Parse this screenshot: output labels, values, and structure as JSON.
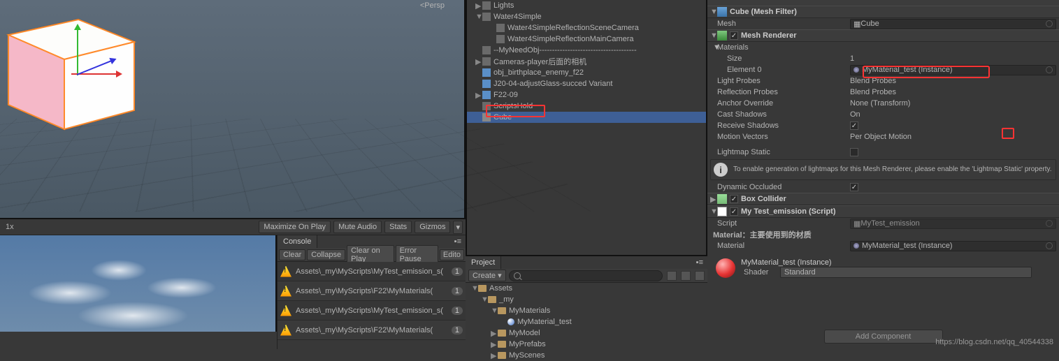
{
  "scene": {
    "camera_label": "<Persp"
  },
  "scene_toolbar": {
    "scale": "1x",
    "maximize": "Maximize On Play",
    "mute": "Mute Audio",
    "stats": "Stats",
    "gizmos": "Gizmos"
  },
  "console": {
    "tab": "Console",
    "buttons": {
      "clear": "Clear",
      "collapse": "Collapse",
      "clear_on_play": "Clear on Play",
      "error_pause": "Error Pause",
      "editor": "Edito"
    },
    "logs": [
      {
        "text": "Assets\\_my\\MyScripts\\MyTest_emission_s(",
        "count": "1"
      },
      {
        "text": "Assets\\_my\\MyScripts\\F22\\MyMaterials(",
        "count": "1"
      },
      {
        "text": "Assets\\_my\\MyScripts\\MyTest_emission_s(",
        "count": "1"
      },
      {
        "text": "Assets\\_my\\MyScripts\\F22\\MyMaterials(",
        "count": "1"
      }
    ]
  },
  "hierarchy": {
    "items": [
      {
        "name": "Lights",
        "indent": 1,
        "arrow": "▶",
        "ico": "go"
      },
      {
        "name": "Water4Simple",
        "indent": 1,
        "arrow": "▼",
        "ico": "go"
      },
      {
        "name": "Water4SimpleReflectionSceneCamera",
        "indent": 2,
        "arrow": "",
        "ico": "go"
      },
      {
        "name": "Water4SimpleReflectionMainCamera",
        "indent": 2,
        "arrow": "",
        "ico": "go"
      },
      {
        "name": "--MyNeedObj--------------------------------------",
        "indent": 1,
        "arrow": "",
        "ico": "go"
      },
      {
        "name": "Cameras-player后面的相机",
        "indent": 1,
        "arrow": "▶",
        "ico": "go"
      },
      {
        "name": "obj_birthplace_enemy_f22",
        "indent": 1,
        "arrow": "",
        "ico": "pref"
      },
      {
        "name": "J20-04-adjustGlass-succed Variant",
        "indent": 1,
        "arrow": "",
        "ico": "pref"
      },
      {
        "name": "F22-09",
        "indent": 1,
        "arrow": "▶",
        "ico": "pref"
      },
      {
        "name": "ScriptsHold",
        "indent": 1,
        "arrow": "",
        "ico": "go"
      },
      {
        "name": "Cube",
        "indent": 1,
        "arrow": "",
        "ico": "cube",
        "sel": true
      }
    ]
  },
  "project": {
    "tab": "Project",
    "create": "Create",
    "tree": [
      {
        "name": "Assets",
        "indent": 0,
        "arrow": "▼",
        "ico": "folder"
      },
      {
        "name": "_my",
        "indent": 1,
        "arrow": "▼",
        "ico": "folder"
      },
      {
        "name": "MyMaterials",
        "indent": 2,
        "arrow": "▼",
        "ico": "folder"
      },
      {
        "name": "MyMaterial_test",
        "indent": 3,
        "arrow": "",
        "ico": "mat"
      },
      {
        "name": "MyModel",
        "indent": 2,
        "arrow": "▶",
        "ico": "folder"
      },
      {
        "name": "MyPrefabs",
        "indent": 2,
        "arrow": "▶",
        "ico": "folder"
      },
      {
        "name": "MyScenes",
        "indent": 2,
        "arrow": "▶",
        "ico": "folder"
      }
    ]
  },
  "inspector": {
    "mesh_filter": {
      "title": "Cube (Mesh Filter)",
      "mesh_lbl": "Mesh",
      "mesh_val": "Cube"
    },
    "mesh_renderer": {
      "title": "Mesh Renderer",
      "materials": "Materials",
      "size_lbl": "Size",
      "size_val": "1",
      "elem_lbl": "Element 0",
      "elem_val": "MyMaterial_test (Instance)",
      "light_probes_lbl": "Light Probes",
      "light_probes_val": "Blend Probes",
      "refl_probes_lbl": "Reflection Probes",
      "refl_probes_val": "Blend Probes",
      "anchor_lbl": "Anchor Override",
      "anchor_val": "None (Transform)",
      "cast_lbl": "Cast Shadows",
      "cast_val": "On",
      "recv_lbl": "Receive Shadows",
      "motion_lbl": "Motion Vectors",
      "motion_val": "Per Object Motion",
      "lightmap_lbl": "Lightmap Static",
      "info": "To enable generation of lightmaps for this Mesh Renderer, please enable the 'Lightmap Static' property.",
      "dyn_lbl": "Dynamic Occluded"
    },
    "box_collider": {
      "title": "Box Collider"
    },
    "script": {
      "title": "My Test_emission (Script)",
      "script_lbl": "Script",
      "script_val": "MyTest_emission",
      "mat_header": "Material：主要使用到的材质",
      "mat_lbl": "Material",
      "mat_val": "MyMaterial_test (Instance)"
    },
    "mat_preview": {
      "name": "MyMaterial_test (Instance)",
      "shader_lbl": "Shader",
      "shader_val": "Standard"
    },
    "add_component": "Add Component"
  },
  "watermark": "https://blog.csdn.net/qq_40544338"
}
